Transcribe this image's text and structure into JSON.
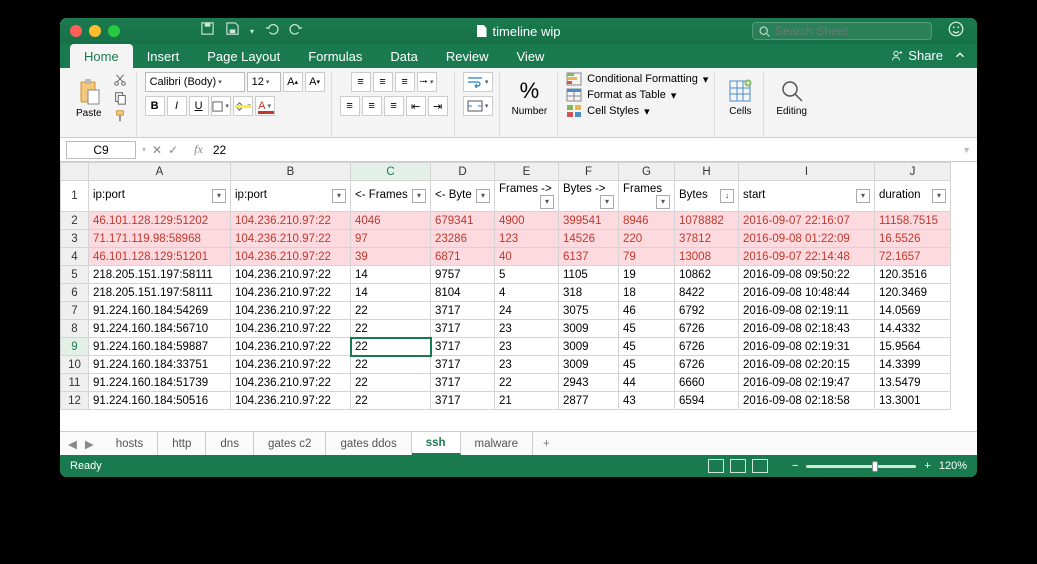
{
  "title": "timeline wip",
  "searchPlaceholder": "Search Sheet",
  "tabs": [
    "Home",
    "Insert",
    "Page Layout",
    "Formulas",
    "Data",
    "Review",
    "View"
  ],
  "activeTab": "Home",
  "share": "Share",
  "ribbon": {
    "paste": "Paste",
    "font": "Calibri (Body)",
    "size": "12",
    "number": "Number",
    "cond": "Conditional Formatting",
    "table": "Format as Table",
    "styles": "Cell Styles",
    "cells": "Cells",
    "editing": "Editing"
  },
  "nameBox": "C9",
  "formula": "22",
  "columns": [
    "",
    "A",
    "B",
    "C",
    "D",
    "E",
    "F",
    "G",
    "H",
    "I",
    "J"
  ],
  "headersRow": [
    "1",
    "ip:port",
    "ip:port",
    "<- Frames",
    "<- Byte",
    "Frames ->",
    "Bytes ->",
    "Frames",
    "Bytes",
    "start",
    "duration"
  ],
  "sortedCol": "H",
  "rows": [
    {
      "n": "2",
      "pink": true,
      "c": [
        "46.101.128.129:51202",
        "104.236.210.97:22",
        "4046",
        "679341",
        "4900",
        "399541",
        "8946",
        "1078882",
        "2016-09-07 22:16:07",
        "11158.7515"
      ]
    },
    {
      "n": "3",
      "pink": true,
      "c": [
        "71.171.119.98:58968",
        "104.236.210.97:22",
        "97",
        "23286",
        "123",
        "14526",
        "220",
        "37812",
        "2016-09-08 01:22:09",
        "16.5526"
      ]
    },
    {
      "n": "4",
      "pink": true,
      "c": [
        "46.101.128.129:51201",
        "104.236.210.97:22",
        "39",
        "6871",
        "40",
        "6137",
        "79",
        "13008",
        "2016-09-07 22:14:48",
        "72.1657"
      ]
    },
    {
      "n": "5",
      "c": [
        "218.205.151.197:58111",
        "104.236.210.97:22",
        "14",
        "9757",
        "5",
        "1105",
        "19",
        "10862",
        "2016-09-08 09:50:22",
        "120.3516"
      ]
    },
    {
      "n": "6",
      "c": [
        "218.205.151.197:58111",
        "104.236.210.97:22",
        "14",
        "8104",
        "4",
        "318",
        "18",
        "8422",
        "2016-09-08 10:48:44",
        "120.3469"
      ]
    },
    {
      "n": "7",
      "c": [
        "91.224.160.184:54269",
        "104.236.210.97:22",
        "22",
        "3717",
        "24",
        "3075",
        "46",
        "6792",
        "2016-09-08 02:19:11",
        "14.0569"
      ]
    },
    {
      "n": "8",
      "c": [
        "91.224.160.184:56710",
        "104.236.210.97:22",
        "22",
        "3717",
        "23",
        "3009",
        "45",
        "6726",
        "2016-09-08 02:18:43",
        "14.4332"
      ]
    },
    {
      "n": "9",
      "sel": "C",
      "c": [
        "91.224.160.184:59887",
        "104.236.210.97:22",
        "22",
        "3717",
        "23",
        "3009",
        "45",
        "6726",
        "2016-09-08 02:19:31",
        "15.9564"
      ]
    },
    {
      "n": "10",
      "c": [
        "91.224.160.184:33751",
        "104.236.210.97:22",
        "22",
        "3717",
        "23",
        "3009",
        "45",
        "6726",
        "2016-09-08 02:20:15",
        "14.3399"
      ]
    },
    {
      "n": "11",
      "c": [
        "91.224.160.184:51739",
        "104.236.210.97:22",
        "22",
        "3717",
        "22",
        "2943",
        "44",
        "6660",
        "2016-09-08 02:19:47",
        "13.5479"
      ]
    },
    {
      "n": "12",
      "c": [
        "91.224.160.184:50516",
        "104.236.210.97:22",
        "22",
        "3717",
        "21",
        "2877",
        "43",
        "6594",
        "2016-09-08 02:18:58",
        "13.3001"
      ]
    }
  ],
  "sheets": [
    "hosts",
    "http",
    "dns",
    "gates c2",
    "gates ddos",
    "ssh",
    "malware"
  ],
  "activeSheet": "ssh",
  "status": "Ready",
  "zoom": "120%"
}
